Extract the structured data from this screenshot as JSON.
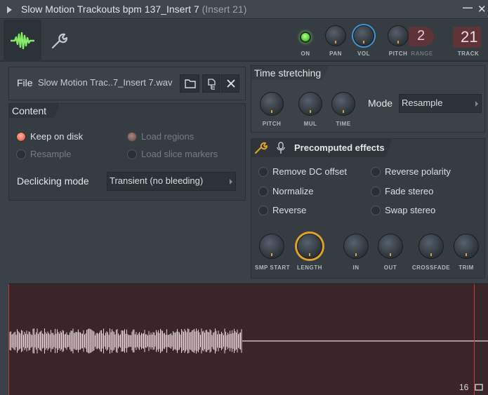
{
  "window": {
    "title": "Slow Motion Trackouts bpm 137_Insert 7",
    "subtitle": "(Insert 21)",
    "minimize": "—",
    "close": "✕"
  },
  "toolbar": {
    "on_label": "ON",
    "pan_label": "PAN",
    "vol_label": "VOL",
    "pitch_label": "PITCH",
    "range_label": "RANGE",
    "range_value": "2",
    "track_label": "TRACK",
    "track_value": "21",
    "icons": [
      "waveform-icon",
      "wrench-icon"
    ]
  },
  "file": {
    "label": "File",
    "name": "Slow Motion Trac..7_Insert 7.wav"
  },
  "content": {
    "header": "Content",
    "options": [
      {
        "label": "Keep on disk",
        "checked": true,
        "enabled": true
      },
      {
        "label": "Load regions",
        "checked": true,
        "enabled": false
      },
      {
        "label": "Resample",
        "checked": false,
        "enabled": false
      },
      {
        "label": "Load slice markers",
        "checked": false,
        "enabled": false
      }
    ],
    "declicking_label": "Declicking mode",
    "declicking_value": "Transient (no bleeding)"
  },
  "time_stretching": {
    "header": "Time stretching",
    "knobs": [
      "PITCH",
      "MUL",
      "TIME"
    ],
    "mode_label": "Mode",
    "mode_value": "Resample"
  },
  "precomputed": {
    "header": "Precomputed effects",
    "effects": [
      "Remove DC offset",
      "Normalize",
      "Reverse",
      "Reverse polarity",
      "Fade stereo",
      "Swap stereo"
    ],
    "knobs": [
      "SMP START",
      "LENGTH",
      "IN",
      "OUT",
      "CROSSFADE",
      "TRIM"
    ]
  },
  "waveform": {
    "footer_value": "16",
    "colors": {
      "background": "#3a2528",
      "wave": "#e8d6d8",
      "marker": "#c53a3a"
    }
  }
}
